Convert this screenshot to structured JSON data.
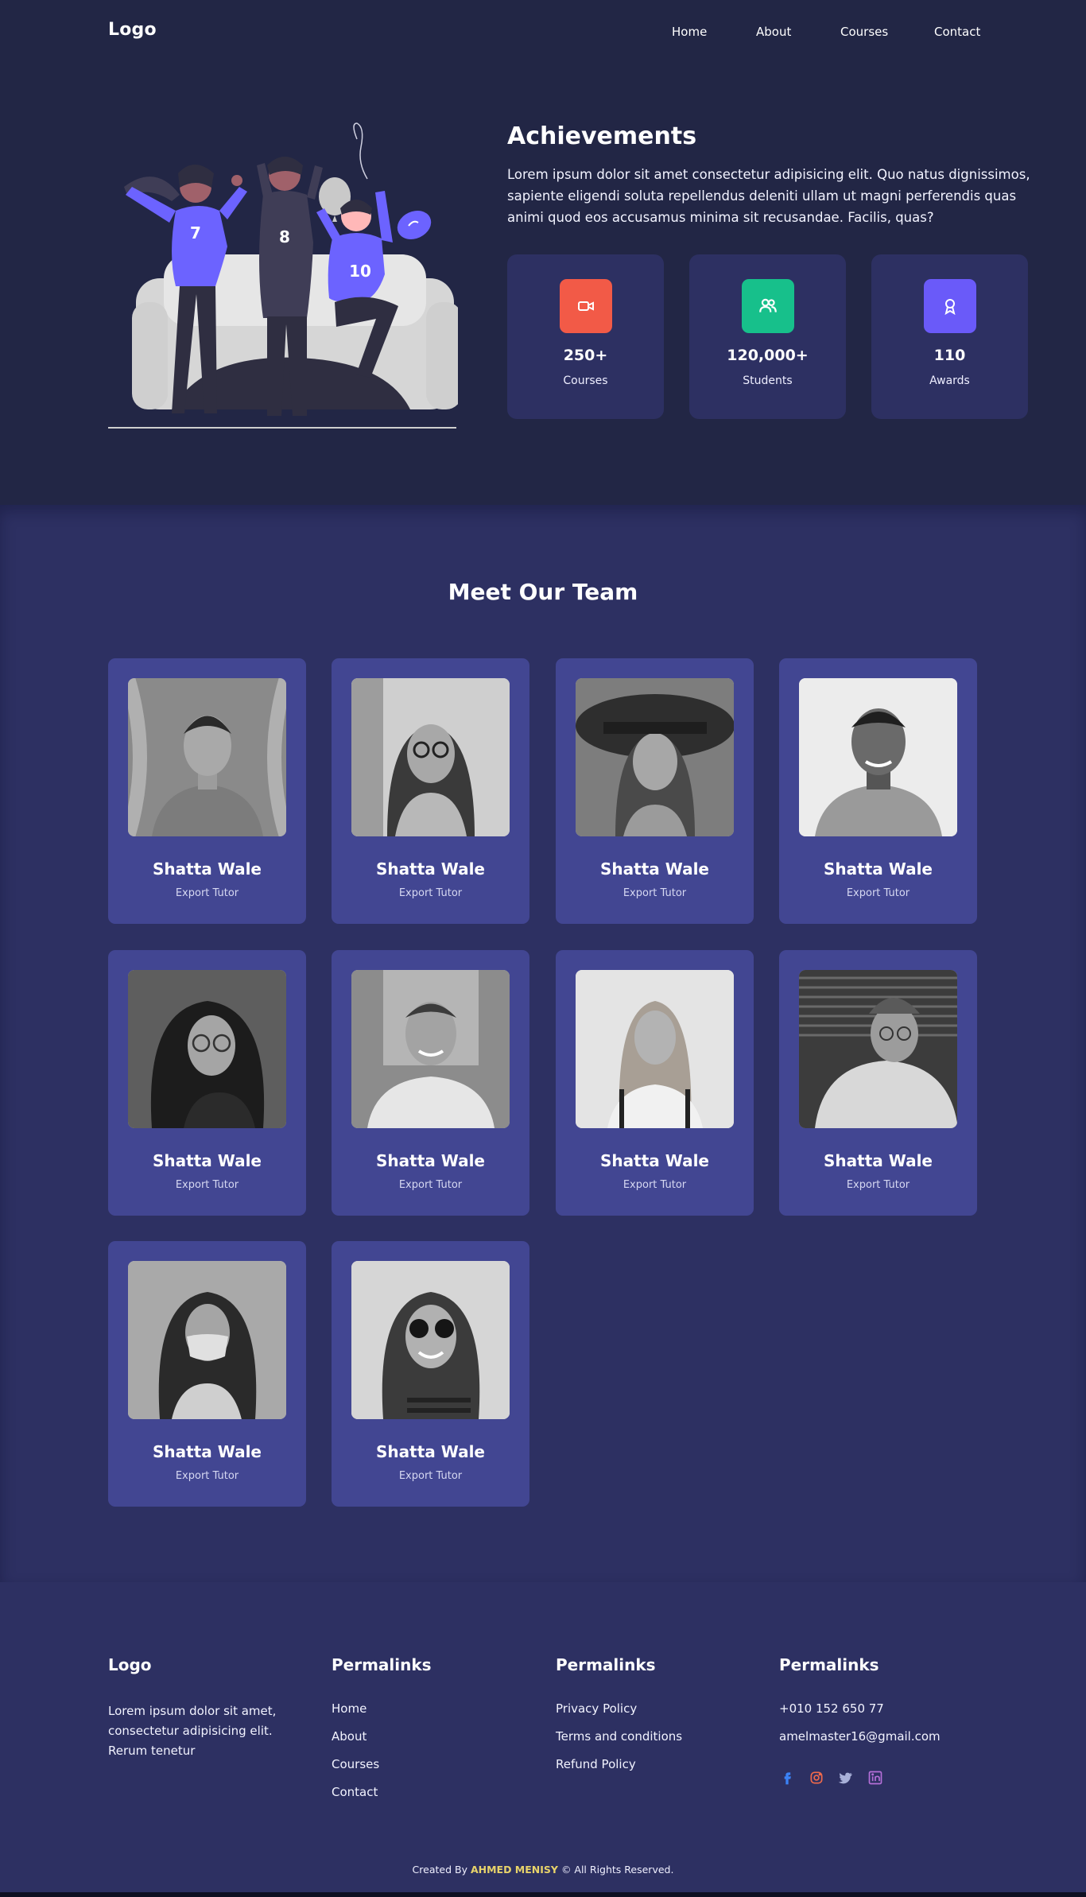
{
  "nav": {
    "logo": "Logo",
    "links": [
      "Home",
      "About",
      "Courses",
      "Contact"
    ]
  },
  "achievements": {
    "title": "Achievements",
    "text": "Lorem ipsum dolor sit amet consectetur adipisicing elit. Quo natus dignissimos, sapiente eligendi soluta repellendus deleniti ullam ut magni perferendis quas animi quod eos accusamus minima sit recusandae. Facilis, quas?",
    "illustration_numbers": [
      "7",
      "8",
      "10"
    ],
    "stats": [
      {
        "value": "250+",
        "label": "Courses",
        "icon": "video-camera-icon",
        "color": "#f25a47"
      },
      {
        "value": "120,000+",
        "label": "Students",
        "icon": "users-icon",
        "color": "#17c08b"
      },
      {
        "value": "110",
        "label": "Awards",
        "icon": "award-icon",
        "color": "#6a5af9"
      }
    ]
  },
  "team": {
    "title": "Meet Our Team",
    "members": [
      {
        "name": "Shatta Wale",
        "role": "Export Tutor"
      },
      {
        "name": "Shatta Wale",
        "role": "Export Tutor"
      },
      {
        "name": "Shatta Wale",
        "role": "Export Tutor"
      },
      {
        "name": "Shatta Wale",
        "role": "Export Tutor"
      },
      {
        "name": "Shatta Wale",
        "role": "Export Tutor"
      },
      {
        "name": "Shatta Wale",
        "role": "Export Tutor"
      },
      {
        "name": "Shatta Wale",
        "role": "Export Tutor"
      },
      {
        "name": "Shatta Wale",
        "role": "Export Tutor"
      },
      {
        "name": "Shatta Wale",
        "role": "Export Tutor"
      },
      {
        "name": "Shatta Wale",
        "role": "Export Tutor"
      }
    ]
  },
  "footer": {
    "logo": "Logo",
    "about": "Lorem ipsum dolor sit amet, consectetur adipisicing elit. Rerum tenetur",
    "col1": {
      "title": "Permalinks",
      "links": [
        "Home",
        "About",
        "Courses",
        "Contact"
      ]
    },
    "col2": {
      "title": "Permalinks",
      "links": [
        "Privacy Policy",
        "Terms and conditions",
        "Refund Policy"
      ]
    },
    "col3": {
      "title": "Permalinks",
      "phone": "+010 152 650 77",
      "email": "amelmaster16@gmail.com",
      "socials": [
        {
          "icon": "facebook-icon",
          "color": "#3b82f6"
        },
        {
          "icon": "instagram-icon",
          "color": "#f26a4b"
        },
        {
          "icon": "twitter-icon",
          "color": "#a8b0d8"
        },
        {
          "icon": "linkedin-icon",
          "color": "#b56fd8"
        }
      ]
    },
    "credit_prefix": "Created By",
    "credit_author": "AHMED MENISY",
    "credit_suffix": "© All Rights Reserved."
  }
}
